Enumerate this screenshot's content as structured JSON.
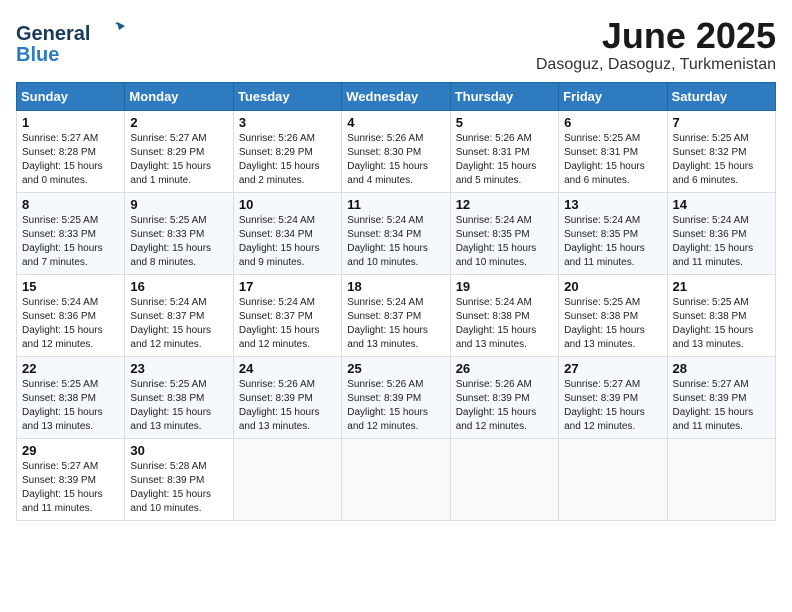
{
  "header": {
    "logo_general": "General",
    "logo_blue": "Blue",
    "month_title": "June 2025",
    "location": "Dasoguz, Dasoguz, Turkmenistan"
  },
  "weekdays": [
    "Sunday",
    "Monday",
    "Tuesday",
    "Wednesday",
    "Thursday",
    "Friday",
    "Saturday"
  ],
  "weeks": [
    [
      {
        "day": "1",
        "sunrise": "5:27 AM",
        "sunset": "8:28 PM",
        "daylight": "15 hours and 0 minutes."
      },
      {
        "day": "2",
        "sunrise": "5:27 AM",
        "sunset": "8:29 PM",
        "daylight": "15 hours and 1 minute."
      },
      {
        "day": "3",
        "sunrise": "5:26 AM",
        "sunset": "8:29 PM",
        "daylight": "15 hours and 2 minutes."
      },
      {
        "day": "4",
        "sunrise": "5:26 AM",
        "sunset": "8:30 PM",
        "daylight": "15 hours and 4 minutes."
      },
      {
        "day": "5",
        "sunrise": "5:26 AM",
        "sunset": "8:31 PM",
        "daylight": "15 hours and 5 minutes."
      },
      {
        "day": "6",
        "sunrise": "5:25 AM",
        "sunset": "8:31 PM",
        "daylight": "15 hours and 6 minutes."
      },
      {
        "day": "7",
        "sunrise": "5:25 AM",
        "sunset": "8:32 PM",
        "daylight": "15 hours and 6 minutes."
      }
    ],
    [
      {
        "day": "8",
        "sunrise": "5:25 AM",
        "sunset": "8:33 PM",
        "daylight": "15 hours and 7 minutes."
      },
      {
        "day": "9",
        "sunrise": "5:25 AM",
        "sunset": "8:33 PM",
        "daylight": "15 hours and 8 minutes."
      },
      {
        "day": "10",
        "sunrise": "5:24 AM",
        "sunset": "8:34 PM",
        "daylight": "15 hours and 9 minutes."
      },
      {
        "day": "11",
        "sunrise": "5:24 AM",
        "sunset": "8:34 PM",
        "daylight": "15 hours and 10 minutes."
      },
      {
        "day": "12",
        "sunrise": "5:24 AM",
        "sunset": "8:35 PM",
        "daylight": "15 hours and 10 minutes."
      },
      {
        "day": "13",
        "sunrise": "5:24 AM",
        "sunset": "8:35 PM",
        "daylight": "15 hours and 11 minutes."
      },
      {
        "day": "14",
        "sunrise": "5:24 AM",
        "sunset": "8:36 PM",
        "daylight": "15 hours and 11 minutes."
      }
    ],
    [
      {
        "day": "15",
        "sunrise": "5:24 AM",
        "sunset": "8:36 PM",
        "daylight": "15 hours and 12 minutes."
      },
      {
        "day": "16",
        "sunrise": "5:24 AM",
        "sunset": "8:37 PM",
        "daylight": "15 hours and 12 minutes."
      },
      {
        "day": "17",
        "sunrise": "5:24 AM",
        "sunset": "8:37 PM",
        "daylight": "15 hours and 12 minutes."
      },
      {
        "day": "18",
        "sunrise": "5:24 AM",
        "sunset": "8:37 PM",
        "daylight": "15 hours and 13 minutes."
      },
      {
        "day": "19",
        "sunrise": "5:24 AM",
        "sunset": "8:38 PM",
        "daylight": "15 hours and 13 minutes."
      },
      {
        "day": "20",
        "sunrise": "5:25 AM",
        "sunset": "8:38 PM",
        "daylight": "15 hours and 13 minutes."
      },
      {
        "day": "21",
        "sunrise": "5:25 AM",
        "sunset": "8:38 PM",
        "daylight": "15 hours and 13 minutes."
      }
    ],
    [
      {
        "day": "22",
        "sunrise": "5:25 AM",
        "sunset": "8:38 PM",
        "daylight": "15 hours and 13 minutes."
      },
      {
        "day": "23",
        "sunrise": "5:25 AM",
        "sunset": "8:38 PM",
        "daylight": "15 hours and 13 minutes."
      },
      {
        "day": "24",
        "sunrise": "5:26 AM",
        "sunset": "8:39 PM",
        "daylight": "15 hours and 13 minutes."
      },
      {
        "day": "25",
        "sunrise": "5:26 AM",
        "sunset": "8:39 PM",
        "daylight": "15 hours and 12 minutes."
      },
      {
        "day": "26",
        "sunrise": "5:26 AM",
        "sunset": "8:39 PM",
        "daylight": "15 hours and 12 minutes."
      },
      {
        "day": "27",
        "sunrise": "5:27 AM",
        "sunset": "8:39 PM",
        "daylight": "15 hours and 12 minutes."
      },
      {
        "day": "28",
        "sunrise": "5:27 AM",
        "sunset": "8:39 PM",
        "daylight": "15 hours and 11 minutes."
      }
    ],
    [
      {
        "day": "29",
        "sunrise": "5:27 AM",
        "sunset": "8:39 PM",
        "daylight": "15 hours and 11 minutes."
      },
      {
        "day": "30",
        "sunrise": "5:28 AM",
        "sunset": "8:39 PM",
        "daylight": "15 hours and 10 minutes."
      },
      null,
      null,
      null,
      null,
      null
    ]
  ]
}
